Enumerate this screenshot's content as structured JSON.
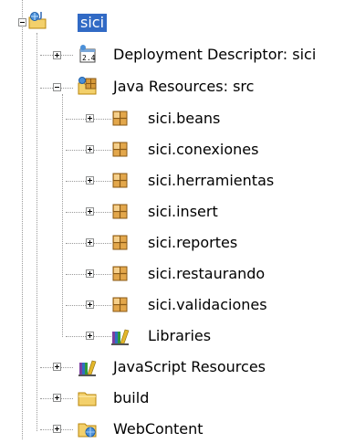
{
  "project": {
    "name": "sici",
    "children": [
      {
        "label": "Deployment Descriptor: sici",
        "icon": "deployment-descriptor-icon"
      },
      {
        "label": "Java Resources: src",
        "icon": "java-resources-icon"
      },
      {
        "label": "JavaScript Resources",
        "icon": "library-icon"
      },
      {
        "label": "build",
        "icon": "folder-icon"
      },
      {
        "label": "WebContent",
        "icon": "webcontent-folder-icon"
      }
    ],
    "java_resources_children": [
      {
        "label": "sici.beans",
        "icon": "package-icon"
      },
      {
        "label": "sici.conexiones",
        "icon": "package-icon"
      },
      {
        "label": "sici.herramientas",
        "icon": "package-icon"
      },
      {
        "label": "sici.insert",
        "icon": "package-icon"
      },
      {
        "label": "sici.reportes",
        "icon": "package-icon"
      },
      {
        "label": "sici.restaurando",
        "icon": "package-icon"
      },
      {
        "label": "sici.validaciones",
        "icon": "package-icon"
      },
      {
        "label": "Libraries",
        "icon": "library-icon"
      }
    ]
  },
  "colors": {
    "selection": "#316ac5",
    "package": "#c98a2f",
    "folder": "#f3d06b"
  }
}
